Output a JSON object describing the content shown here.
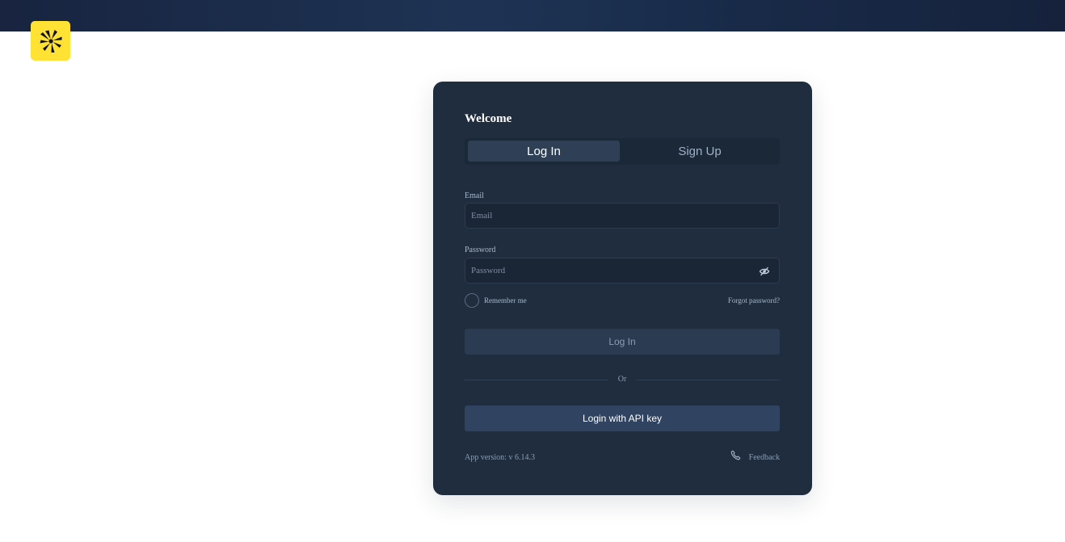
{
  "brand": {
    "logo_icon": "yellow-burst-logo-icon",
    "color": "#ffe234"
  },
  "login": {
    "heading": "Welcome",
    "tabs": [
      {
        "label": "Log In",
        "active": true
      },
      {
        "label": "Sign Up",
        "active": false
      }
    ],
    "email": {
      "label": "Email",
      "placeholder": "Email",
      "value": ""
    },
    "password": {
      "label": "Password",
      "placeholder": "Password",
      "value": "",
      "toggle_icon": "eye-off-icon"
    },
    "remember_me": {
      "label": "Remember me",
      "checked": false
    },
    "forgot_password": "Forgot password?",
    "submit_label": "Log In",
    "divider": "Or",
    "api_key_label": "Login with API key",
    "app_version": "App version: v 6.14.3",
    "feedback": {
      "label": "Feedback",
      "icon": "phone-icon"
    }
  },
  "colors": {
    "topbar": "#1e3354",
    "card": "#1f2d3f",
    "primary_button": "#304360",
    "text_muted": "#8c9db4"
  }
}
